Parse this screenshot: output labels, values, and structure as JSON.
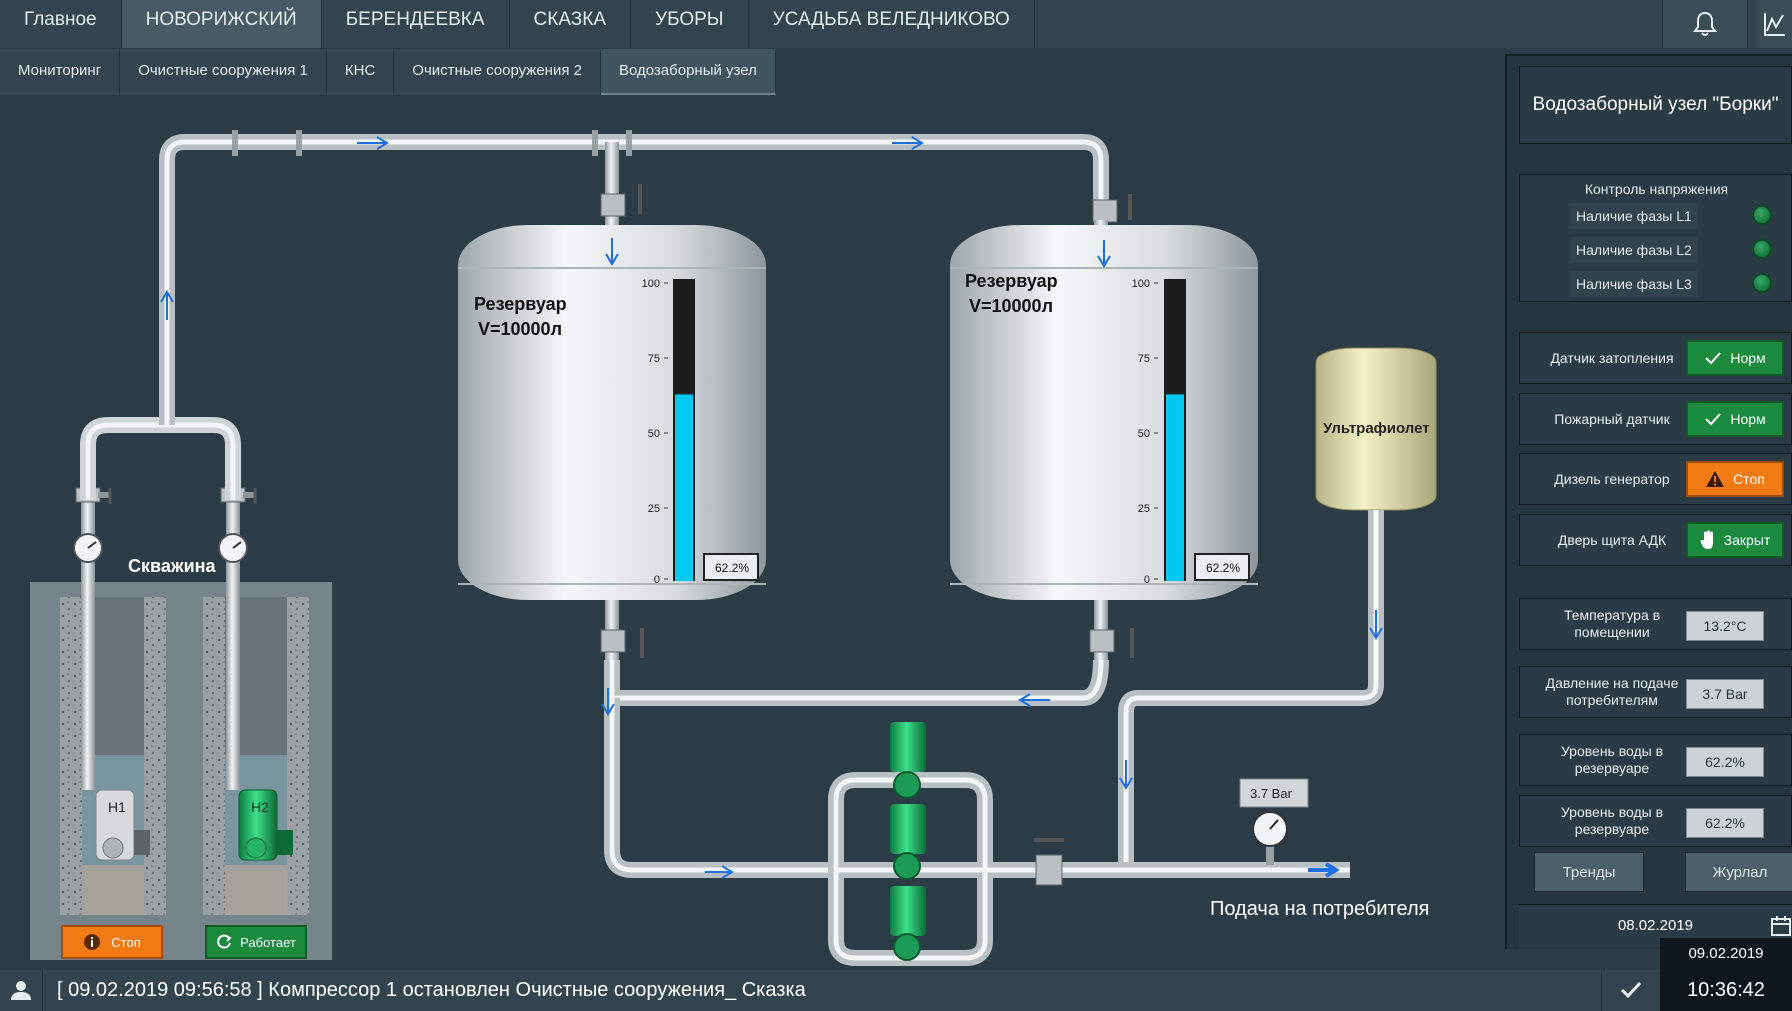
{
  "nav": {
    "tabs": [
      "Главное",
      "НОВОРИЖСКИЙ",
      "БЕРЕНДЕЕВКА",
      "СКАЗКА",
      "УБОРЫ",
      "УСАДЬБА ВЕЛЕДНИКОВО"
    ],
    "subtabs": [
      "Мониторинг",
      "Очистные сооружения 1",
      "КНС",
      "Очистные сооружения 2",
      "Водозаборный узел"
    ]
  },
  "diagram": {
    "well_label": "Скважина",
    "pump1_label": "Н1",
    "pump2_label": "Н2",
    "pump1_status": "Стоп",
    "pump2_status": "Работает",
    "tank1_title": "Резервуар",
    "tank1_volume": "V=10000л",
    "tank2_title": "Резервуар",
    "tank2_volume": "V=10000л",
    "tank1_level_text": "62.2%",
    "tank2_level_text": "62.2%",
    "tank1_level": 0.622,
    "tank2_level": 0.622,
    "scale_ticks": [
      "100",
      "75",
      "50",
      "25",
      "0"
    ],
    "uv_label": "Ультрафиолет",
    "pressure_value": "3.7 Bar",
    "consumer_label": "Подача на потребителя"
  },
  "panel": {
    "title": "Водозаборный узел \"Борки\"",
    "phase_title": "Контроль напряжения",
    "phases": [
      "Наличие фазы L1",
      "Наличие фазы L2",
      "Наличие фазы L3"
    ],
    "flood_label": "Датчик затопления",
    "flood_status": "Норм",
    "fire_label": "Пожарный датчик",
    "fire_status": "Норм",
    "diesel_label": "Дизель генератор",
    "diesel_status": "Стоп",
    "door_label": "Дверь щита АДК",
    "door_status": "Закрыт",
    "temp_label": "Температура в помещении",
    "temp_value": "13.2°C",
    "pressure_label": "Давление на подаче потребителям",
    "pressure_value": "3.7 Bar",
    "level1_label": "Уровень воды в резервуаре",
    "level1_value": "62.2%",
    "level2_label": "Уровень воды в резервуаре",
    "level2_value": "62.2%",
    "trends_button": "Тренды",
    "journal_button": "Журлал",
    "date": "08.02.2019"
  },
  "status": {
    "message": "[ 09.02.2019  09:56:58 ]  Компрессор 1 остановлен Очистные сооружения_ Сказка",
    "date": "09.02.2019",
    "time": "10:36:42"
  },
  "colors": {
    "background": "#2b3c46",
    "water": "#00c8f0",
    "ok": "#1b8a3c",
    "warn": "#f07a14",
    "pump_running": "#1fbf6a",
    "flow_arrow": "#1f6fe0"
  }
}
